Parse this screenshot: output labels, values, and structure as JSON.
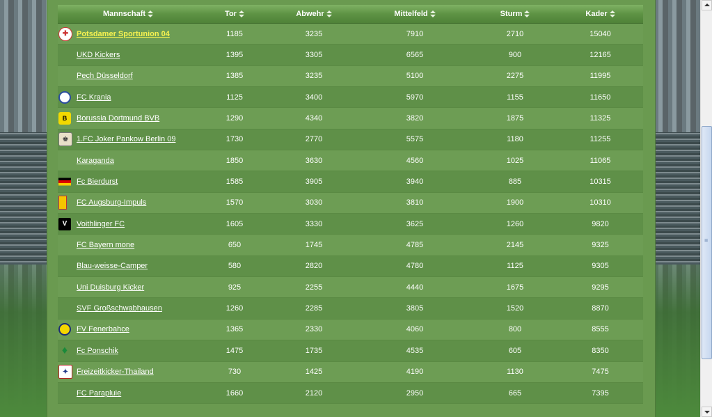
{
  "columns": [
    {
      "label": "Mannschaft"
    },
    {
      "label": "Tor"
    },
    {
      "label": "Abwehr"
    },
    {
      "label": "Mittelfeld"
    },
    {
      "label": "Sturm"
    },
    {
      "label": "Kader"
    }
  ],
  "rows": [
    {
      "team": "Potsdamer Sportunion 04",
      "logo": "potsdam-crest-icon",
      "tor": "1185",
      "abwehr": "3235",
      "mittelfeld": "7910",
      "sturm": "2710",
      "kader": "15040",
      "highlighted": true
    },
    {
      "team": "UKD Kickers",
      "logo": "",
      "tor": "1395",
      "abwehr": "3305",
      "mittelfeld": "6565",
      "sturm": "900",
      "kader": "12165"
    },
    {
      "team": "Pech Düsseldorf",
      "logo": "",
      "tor": "1385",
      "abwehr": "3235",
      "mittelfeld": "5100",
      "sturm": "2275",
      "kader": "11995"
    },
    {
      "team": "FC Krania",
      "logo": "krania-crest-icon",
      "tor": "1125",
      "abwehr": "3400",
      "mittelfeld": "5970",
      "sturm": "1155",
      "kader": "11650"
    },
    {
      "team": "Borussia Dortmund BVB",
      "logo": "bvb-crest-icon",
      "tor": "1290",
      "abwehr": "4340",
      "mittelfeld": "3820",
      "sturm": "1875",
      "kader": "11325"
    },
    {
      "team": "1.FC Joker Pankow Berlin 09",
      "logo": "joker-crest-icon",
      "tor": "1730",
      "abwehr": "2770",
      "mittelfeld": "5575",
      "sturm": "1180",
      "kader": "11255"
    },
    {
      "team": "Karaganda",
      "logo": "",
      "tor": "1850",
      "abwehr": "3630",
      "mittelfeld": "4560",
      "sturm": "1025",
      "kader": "11065"
    },
    {
      "team": "Fc Bierdurst",
      "logo": "german-flag-icon",
      "tor": "1585",
      "abwehr": "3905",
      "mittelfeld": "3940",
      "sturm": "885",
      "kader": "10315"
    },
    {
      "team": "FC Augsburg-Impuls",
      "logo": "augsburg-crest-icon",
      "tor": "1570",
      "abwehr": "3030",
      "mittelfeld": "3810",
      "sturm": "1900",
      "kader": "10310"
    },
    {
      "team": "Voithlinger FC",
      "logo": "voith-crest-icon",
      "tor": "1605",
      "abwehr": "3330",
      "mittelfeld": "3625",
      "sturm": "1260",
      "kader": "9820"
    },
    {
      "team": "FC Bayern mone",
      "logo": "",
      "tor": "650",
      "abwehr": "1745",
      "mittelfeld": "4785",
      "sturm": "2145",
      "kader": "9325"
    },
    {
      "team": "Blau-weisse-Camper",
      "logo": "",
      "tor": "580",
      "abwehr": "2820",
      "mittelfeld": "4780",
      "sturm": "1125",
      "kader": "9305"
    },
    {
      "team": "Uni Duisburg Kicker",
      "logo": "",
      "tor": "925",
      "abwehr": "2255",
      "mittelfeld": "4440",
      "sturm": "1675",
      "kader": "9295"
    },
    {
      "team": "SVF Großschwabhausen",
      "logo": "",
      "tor": "1260",
      "abwehr": "2285",
      "mittelfeld": "3805",
      "sturm": "1520",
      "kader": "8870"
    },
    {
      "team": "FV Fenerbahce",
      "logo": "fenerbahce-crest-icon",
      "tor": "1365",
      "abwehr": "2330",
      "mittelfeld": "4060",
      "sturm": "800",
      "kader": "8555"
    },
    {
      "team": "Fc Ponschik",
      "logo": "werder-crest-icon",
      "tor": "1475",
      "abwehr": "1735",
      "mittelfeld": "4535",
      "sturm": "605",
      "kader": "8350"
    },
    {
      "team": "Freizeitkicker-Thailand",
      "logo": "freizeit-crest-icon",
      "tor": "730",
      "abwehr": "1425",
      "mittelfeld": "4190",
      "sturm": "1130",
      "kader": "7475"
    },
    {
      "team": "FC Parapluie",
      "logo": "",
      "tor": "1660",
      "abwehr": "2120",
      "mittelfeld": "2950",
      "sturm": "665",
      "kader": "7395"
    }
  ],
  "colors": {
    "highlight": "#f6f250",
    "panel": "#6a9a50"
  }
}
